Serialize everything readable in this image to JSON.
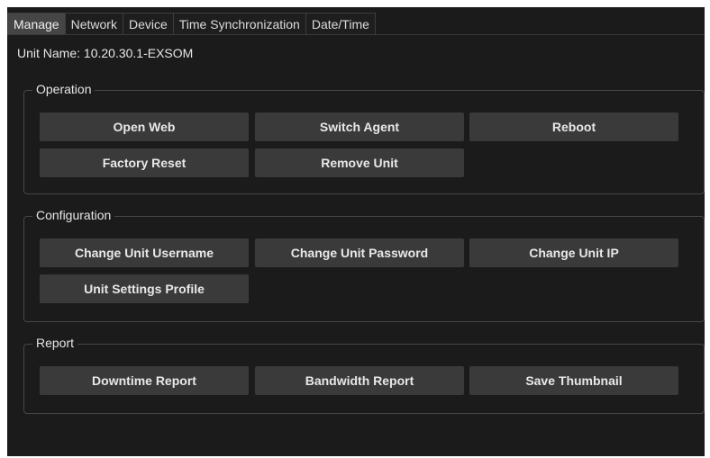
{
  "tabs": [
    "Manage",
    "Network",
    "Device",
    "Time Synchronization",
    "Date/Time"
  ],
  "unit_name": "Unit Name: 10.20.30.1-EXSOM",
  "operation": {
    "title": "Operation",
    "open_web": "Open Web",
    "switch_agent": "Switch Agent",
    "reboot": "Reboot",
    "factory_reset": "Factory Reset",
    "remove_unit": "Remove Unit"
  },
  "configuration": {
    "title": "Configuration",
    "change_username": "Change Unit Username",
    "change_password": "Change Unit Password",
    "change_ip": "Change Unit IP",
    "settings_profile": "Unit Settings Profile"
  },
  "report": {
    "title": "Report",
    "downtime": "Downtime Report",
    "bandwidth": "Bandwidth Report",
    "thumbnail": "Save Thumbnail"
  },
  "colors": {
    "panel_background": "#1b1b1b",
    "button_background": "#3a3a3a",
    "active_tab": "#454545",
    "group_border": "#474747"
  }
}
